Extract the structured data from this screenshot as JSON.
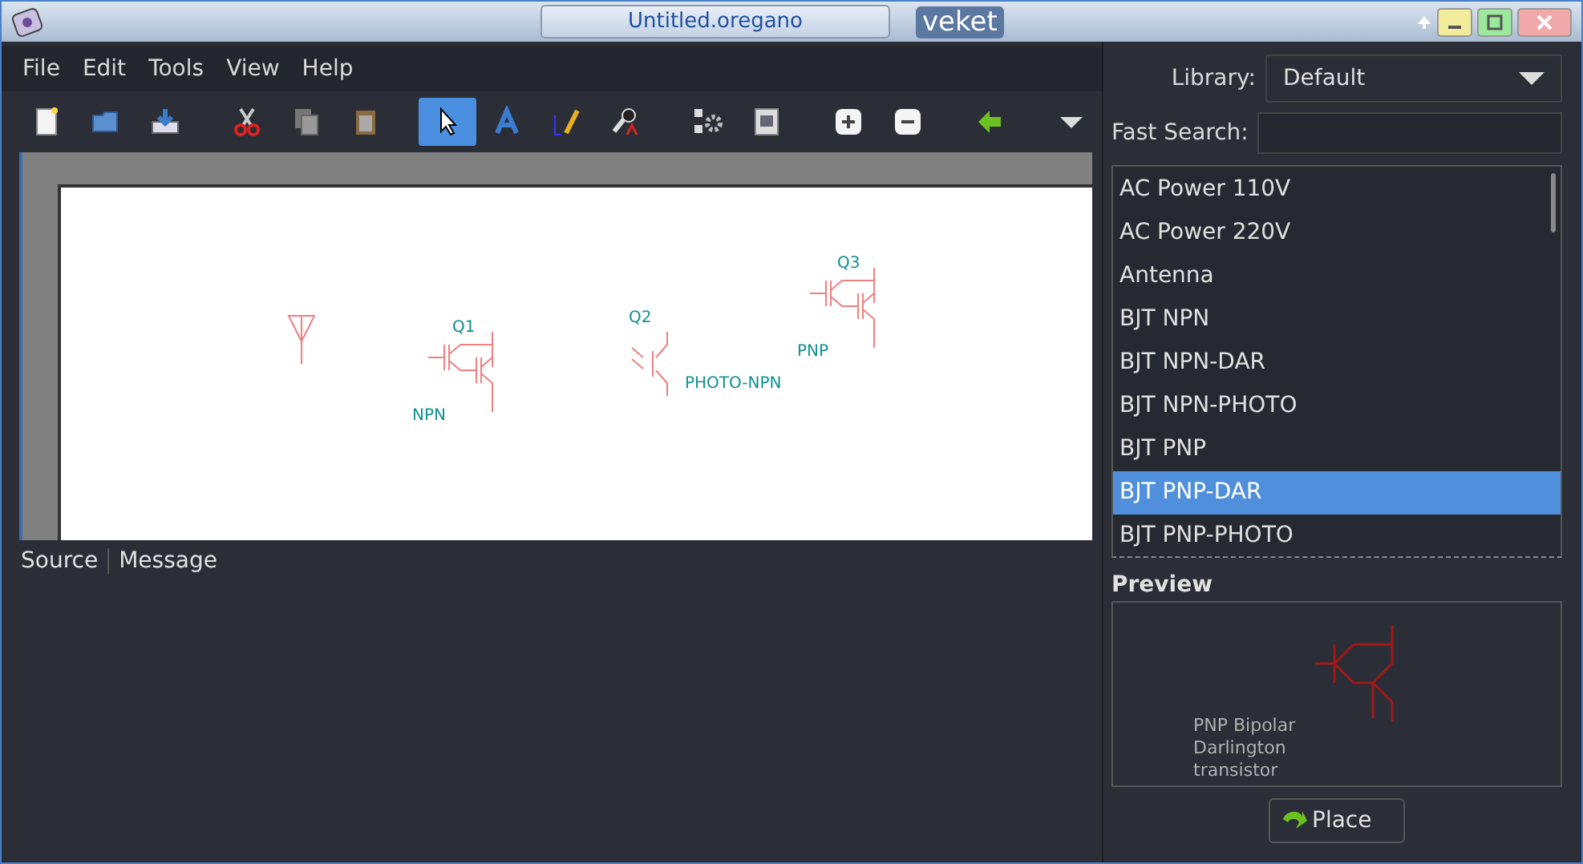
{
  "window": {
    "title": "Untitled.oregano",
    "host": "veket"
  },
  "menu": [
    "File",
    "Edit",
    "Tools",
    "View",
    "Help"
  ],
  "toolbar": [
    {
      "kind": "new",
      "selected": false
    },
    {
      "kind": "open",
      "selected": false
    },
    {
      "kind": "save",
      "selected": false
    },
    {
      "kind": "cut",
      "selected": false
    },
    {
      "kind": "copy",
      "selected": false
    },
    {
      "kind": "paste",
      "selected": false
    },
    {
      "kind": "pointer",
      "selected": true
    },
    {
      "kind": "text",
      "selected": false
    },
    {
      "kind": "wire",
      "selected": false
    },
    {
      "kind": "probe",
      "selected": false
    },
    {
      "kind": "netlist",
      "selected": false
    },
    {
      "kind": "preview",
      "selected": false
    },
    {
      "kind": "zoom-in",
      "selected": false
    },
    {
      "kind": "zoom-out",
      "selected": false
    },
    {
      "kind": "back",
      "selected": false
    },
    {
      "kind": "more",
      "selected": false
    }
  ],
  "canvas": {
    "parts": [
      {
        "kind": "antenna"
      },
      {
        "kind": "npn-dar",
        "ref": "Q1",
        "value": "NPN"
      },
      {
        "kind": "npn-photo",
        "ref": "Q2",
        "value": "PHOTO-NPN"
      },
      {
        "kind": "pnp-dar",
        "ref": "Q3",
        "value": "PNP"
      }
    ]
  },
  "log": {
    "columns": [
      "Source",
      "Message"
    ]
  },
  "library": {
    "label": "Library:",
    "value": "Default"
  },
  "search": {
    "label": "Fast Search:"
  },
  "parts": [
    {
      "name": "AC Power 110V",
      "selected": false
    },
    {
      "name": "AC Power 220V",
      "selected": false
    },
    {
      "name": "Antenna",
      "selected": false
    },
    {
      "name": "BJT NPN",
      "selected": false
    },
    {
      "name": "BJT NPN-DAR",
      "selected": false
    },
    {
      "name": "BJT NPN-PHOTO",
      "selected": false
    },
    {
      "name": "BJT PNP",
      "selected": false
    },
    {
      "name": "BJT PNP-DAR",
      "selected": true
    },
    {
      "name": "BJT PNP-PHOTO",
      "selected": false
    }
  ],
  "preview": {
    "title": "Preview",
    "description": "PNP Bipolar Darlington transistor"
  },
  "place_button": "Place"
}
